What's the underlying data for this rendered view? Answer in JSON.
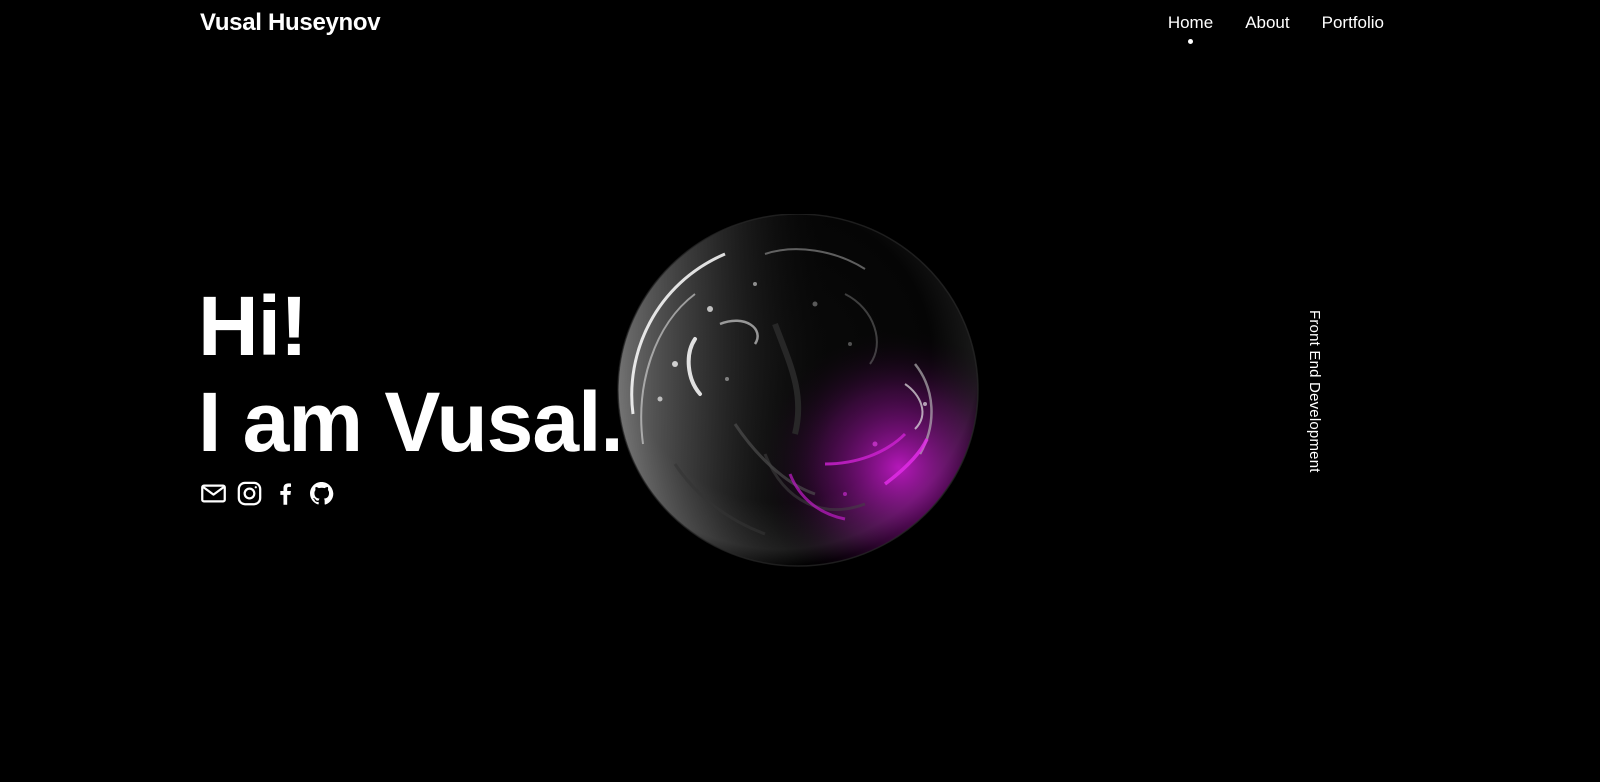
{
  "header": {
    "brand": "Vusal Huseynov",
    "nav": [
      {
        "label": "Home",
        "active": true
      },
      {
        "label": "About",
        "active": false
      },
      {
        "label": "Portfolio",
        "active": false
      }
    ]
  },
  "hero": {
    "line1": "Hi!",
    "line2": "I am Vusal."
  },
  "socials": [
    {
      "icon": "mail-icon"
    },
    {
      "icon": "instagram-icon"
    },
    {
      "icon": "facebook-icon"
    },
    {
      "icon": "github-icon"
    }
  ],
  "side": {
    "tagline": "Front End Development"
  },
  "colors": {
    "background": "#000000",
    "text": "#ffffff",
    "accent": "#c318c8"
  }
}
